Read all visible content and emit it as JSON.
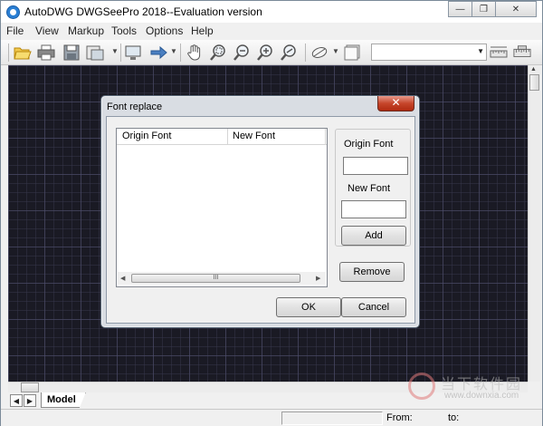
{
  "window": {
    "title": "AutoDWG DWGSeePro 2018--Evaluation version",
    "minimize_glyph": "—",
    "restore_glyph": "❐",
    "close_glyph": "✕"
  },
  "menu": {
    "items": [
      "File",
      "View",
      "Markup",
      "Tools",
      "Options",
      "Help"
    ]
  },
  "toolbar": {
    "icons": [
      "open-folder-icon",
      "print-icon",
      "save-icon",
      "export-icon",
      "display-icon",
      "arrow-right-icon",
      "pan-hand-icon",
      "zoom-window-icon",
      "zoom-out-icon",
      "zoom-in-icon",
      "zoom-realtime-icon",
      "layer-icon",
      "layer-state-icon",
      "measure-icon",
      "ruler-icon"
    ],
    "layer_value": ""
  },
  "layout_tabs": {
    "active": "Model"
  },
  "statusbar": {
    "from_label": "From:",
    "to_label": "to:"
  },
  "dialog": {
    "title": "Font replace",
    "close_glyph": "✕",
    "list_columns": [
      "Origin Font",
      "New Font"
    ],
    "list_rows": [],
    "scroll_thumb_glyph": "III",
    "origin_font_label": "Origin Font",
    "origin_font_value": "",
    "new_font_label": "New Font",
    "new_font_value": "",
    "add_label": "Add",
    "remove_label": "Remove",
    "ok_label": "OK",
    "cancel_label": "Cancel"
  },
  "watermark": {
    "text_cn": "当下软件园",
    "url": "www.downxia.com"
  },
  "colors": {
    "canvas_bg": "#1a1a24",
    "dialog_close": "#c6462b"
  }
}
